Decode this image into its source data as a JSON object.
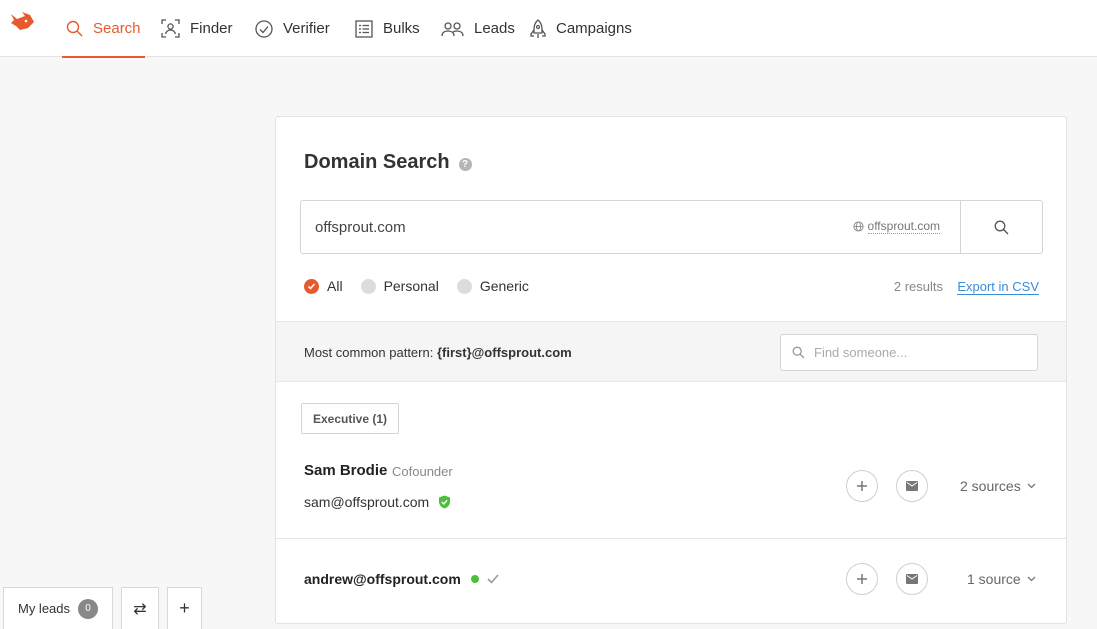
{
  "nav": {
    "logo": "hunter-fox-logo",
    "items": [
      {
        "label": "Search",
        "icon": "search-icon",
        "active": true
      },
      {
        "label": "Finder",
        "icon": "finder-icon",
        "active": false
      },
      {
        "label": "Verifier",
        "icon": "check-circle-icon",
        "active": false
      },
      {
        "label": "Bulks",
        "icon": "list-icon",
        "active": false
      },
      {
        "label": "Leads",
        "icon": "users-icon",
        "active": false
      },
      {
        "label": "Campaigns",
        "icon": "rocket-icon",
        "active": false
      }
    ],
    "accent_color": "#e85a2d"
  },
  "card": {
    "title": "Domain Search",
    "help_icon": "?",
    "search": {
      "value": "offsprout.com",
      "domain_hint": "offsprout.com"
    },
    "filters": [
      {
        "label": "All",
        "selected": true
      },
      {
        "label": "Personal",
        "selected": false
      },
      {
        "label": "Generic",
        "selected": false
      }
    ],
    "results_count": "2 results",
    "export_label": "Export in CSV",
    "pattern": {
      "label": "Most common pattern:",
      "value": "{first}@offsprout.com"
    },
    "find_placeholder": "Find someone...",
    "department": "Executive (1)",
    "people": [
      {
        "name": "Sam Brodie",
        "role": "Cofounder",
        "email": "sam@offsprout.com",
        "sources": "2 sources",
        "verified": true
      },
      {
        "name": "",
        "role": "",
        "email": "andrew@offsprout.com",
        "sources": "1 source",
        "verified": false
      }
    ]
  },
  "bottom": {
    "my_leads_label": "My leads",
    "my_leads_count": "0",
    "swap_label": "⇄",
    "add_label": "+"
  }
}
